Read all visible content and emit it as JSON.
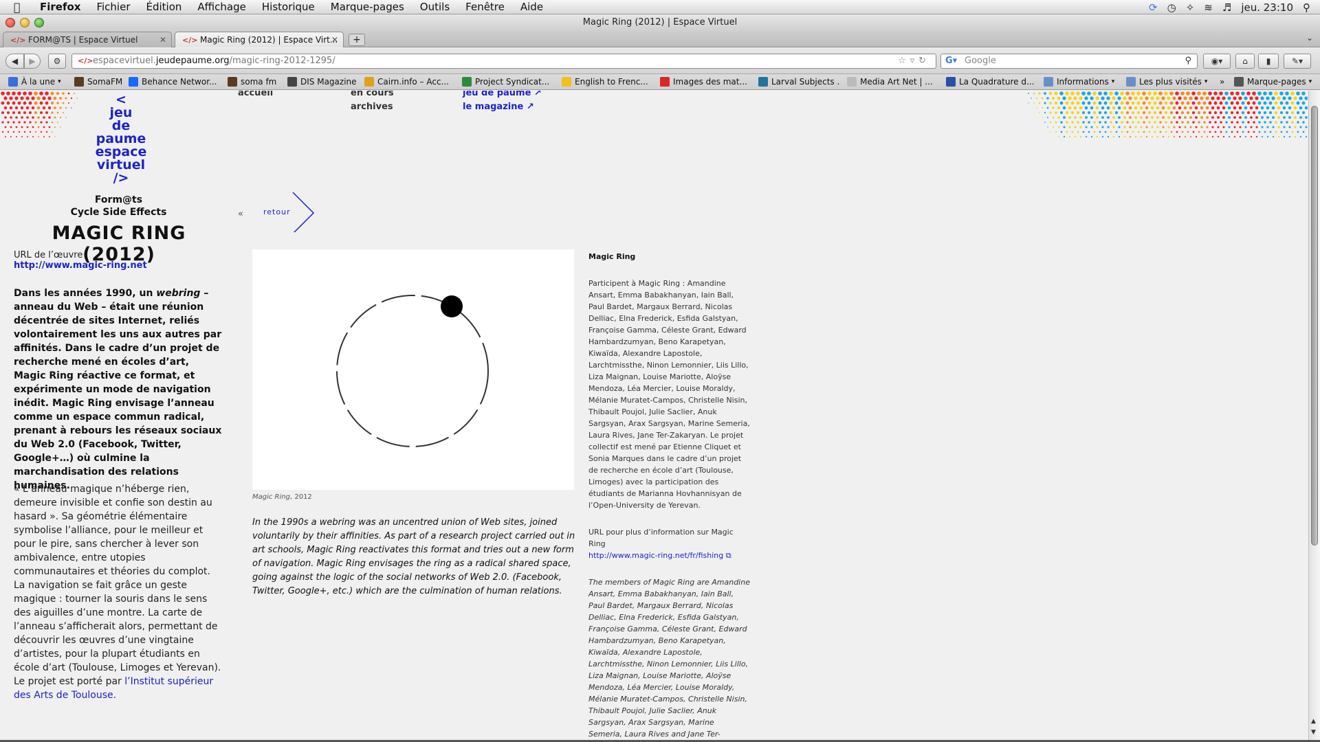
{
  "menubar": {
    "app": "Firefox",
    "menus": [
      "Fichier",
      "Édition",
      "Affichage",
      "Historique",
      "Marque-pages",
      "Outils",
      "Fenêtre",
      "Aide"
    ],
    "clock": "jeu. 23:10"
  },
  "window": {
    "title": "Magic Ring (2012) | Espace Virtuel"
  },
  "tabs": [
    {
      "label": "FORM@TS | Espace Virtuel",
      "active": false
    },
    {
      "label": "Magic Ring (2012) | Espace Virt...",
      "active": true
    }
  ],
  "new_tab_label": "+",
  "navbar": {
    "url_prefix": "espacevirtuel.",
    "url_domain": "jeudepaume.org",
    "url_path": "/magic-ring-2012-1295/",
    "search_placeholder": "Google"
  },
  "bookmarks": [
    {
      "label": "À la une",
      "icon_color": "#3a6fd8",
      "dropdown": true
    },
    {
      "label": "SomaFM",
      "icon_color": "#5a3b1f",
      "dropdown": false
    },
    {
      "label": "Behance Networ...",
      "icon_color": "#1769ff",
      "dropdown": false
    },
    {
      "label": "soma fm",
      "icon_color": "#5a3b1f",
      "dropdown": false
    },
    {
      "label": "DIS Magazine",
      "icon_color": "#444444",
      "dropdown": false
    },
    {
      "label": "Cairn.info – Acc...",
      "icon_color": "#e0a020",
      "dropdown": false
    },
    {
      "label": "Project Syndicat...",
      "icon_color": "#2e8b3a",
      "dropdown": false
    },
    {
      "label": "English to Frenc...",
      "icon_color": "#f0c020",
      "dropdown": false
    },
    {
      "label": "Images des mat...",
      "icon_color": "#d62828",
      "dropdown": false
    },
    {
      "label": "Larval Subjects .",
      "icon_color": "#21759b",
      "dropdown": false
    },
    {
      "label": "Media Art Net | ...",
      "icon_color": "#bbbbbb",
      "dropdown": false
    },
    {
      "label": "La Quadrature d...",
      "icon_color": "#2a4fa8",
      "dropdown": false
    },
    {
      "label": "Informations",
      "icon_color": "#6a8fc8",
      "dropdown": true
    },
    {
      "label": "Les plus visités",
      "icon_color": "#6a8fc8",
      "dropdown": true
    }
  ],
  "bookmarks_more": "»",
  "bookmarks_menu": "Marque-pages",
  "site": {
    "logo_lines": [
      "<",
      "jeu",
      "de",
      "paume",
      "espace",
      "virtuel",
      "/>"
    ],
    "nav": {
      "home": "accueil",
      "current": "en cours",
      "archives": "archives",
      "jdp": "jeu de paume ↗",
      "magazine": "le magazine ↗"
    },
    "cycle_line1": "Form@ts",
    "cycle_line2": "Cycle Side Effects",
    "title": "MAGIC RING (2012)",
    "url_label": "URL de l’œuvre",
    "url": "http://www.magic-ring.net",
    "intro_a": "Dans les années 1990, un ",
    "intro_em": "webring",
    "intro_b": " – anneau du Web – était une réunion décentrée de sites Internet, reliés volontairement les uns aux autres par affinités. Dans le cadre d’un projet de recherche mené en écoles d’art, Magic Ring réactive ce format, et expérimente un mode de navigation inédit. Magic Ring envisage l’anneau comme un espace commun radical, prenant à rebours les réseaux sociaux du Web 2.0 (Facebook, Twitter, Google+…) où culmine la marchandisation des relations humaines.",
    "quote_p1": "« L’anneau magique n’héberge rien, demeure invisible et confie son destin au hasard ». Sa géométrie élémentaire symbolise l’alliance, pour le meilleur et pour le pire, sans chercher à lever son ambivalence, entre utopies communautaires et théories du complot.",
    "quote_p2": "La navigation se fait grâce un geste magique : tourner la souris dans le sens des aiguilles d’une montre. La carte de l’anneau s’afficherait alors, permettant de découvrir les œuvres d’une vingtaine d’artistes, pour la plupart étudiants en école d’art (Toulouse, Limoges et Yerevan).",
    "quote_p3_a": "Le projet est porté par ",
    "quote_p3_link": "l’Institut supérieur des Arts de Toulouse",
    "quote_p3_b": ".",
    "back_arrows": "«",
    "back_label": "retour",
    "caption_em": "Magic Ring",
    "caption_rest": ", 2012",
    "english": "In the 1990s a webring was an uncentred union of Web sites, joined voluntarily by their affinities. As part of a research project carried out in art schools, Magic Ring reactivates this format and tries out a new form of navigation. Magic Ring envisages the ring as a radical shared space, going against the logic of the social networks of Web 2.0. (Facebook, Twitter, Google+, etc.) which are the culmination of human relations.",
    "sidebar_title": "Magic Ring",
    "participants": "Participent à Magic Ring : Amandine Ansart, Emma Babakhanyan, Iain Ball, Paul Bardet, Margaux Berrard, Nicolas Delliac, Elna Frederick, Esfida Galstyan, Françoise Gamma, Céleste Grant, Edward Hambardzumyan, Beno Karapetyan, Kiwaïda, Alexandre Lapostole, Larchtmissthe, Ninon Lemonnier, Liis Lillo, Liza Maignan, Louise Mariotte, Aloÿse Mendoza, Léa Mercier, Louise Moraldy, Mélanie Muratet-Campos, Christelle Nisin, Thibault Poujol, Julie Saclier, Anuk Sargsyan, Arax Sargsyan, Marine Semeria, Laura Rives, Jane Ter-Zakaryan. Le projet collectif est mené par Etienne Cliquet et Sonia Marques dans le cadre d’un projet de recherche en école d’art (Toulouse, Limoges) avec la participation des étudiants de Marianna Hovhannisyan de l’Open-University de Yerevan.",
    "info_label": "URL pour plus d’information sur Magic Ring",
    "info_url": "http://www.magic-ring.net/fr/fishing",
    "members": "The members of Magic Ring are Amandine Ansart, Emma Babakhanyan, Iain Ball, Paul Bardet, Margaux Berrard, Nicolas Delliac, Elna Frederick, Esfida Galstyan, Françoise Gamma, Céleste Grant, Edward Hambardzumyan, Beno Karapetyan, Kiwaïda, Alexandre Lapostole, Larchtmissthe, Ninon Lemonnier, Liis Lillo, Liza Maignan, Louise Mariotte, Aloÿse Mendoza, Léa Mercier, Louise Moraldy, Mélanie Muratet-Campos, Christelle Nisin, Thibault Poujol, Julie Saclier, Anuk Sargsyan, Arax Sargsyan, Marine Semeria, Laura Rives and Jane Ter-Zakaryan. Etienne Cliquet and Sonia Marques lead this"
  },
  "colors": {
    "link_blue": "#1d23c9",
    "dot_red": "#e8262b",
    "dot_yellow": "#f4d31c",
    "dot_cyan": "#1aa6e0",
    "dot_orange": "#f38d1e"
  }
}
